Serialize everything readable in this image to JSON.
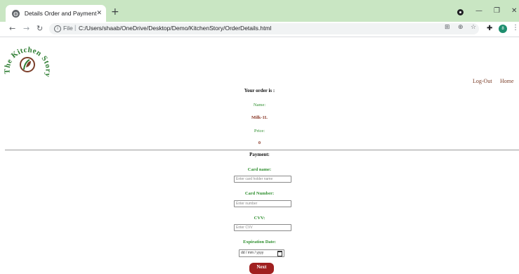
{
  "browser": {
    "tab_title": "Details Order and Payment",
    "tab_close": "✕",
    "new_tab": "+",
    "window_minimize": "—",
    "window_restore": "❐",
    "window_close": "✕",
    "omnibox_label": "File",
    "url": "C:/Users/shaab/OneDrive/Desktop/Demo/KitchenStory/OrderDetails.html",
    "profile_initial": "8"
  },
  "logo": {
    "text": "The Kitchen Story"
  },
  "nav": {
    "logout": "Log-Out",
    "home": "Home"
  },
  "order": {
    "heading": "Your order is :",
    "name_label": "Name:",
    "name_value": "Milk-1L",
    "price_label": "Price:",
    "price_value": "0"
  },
  "payment": {
    "heading": "Payment:",
    "card_name_label": "Card name:",
    "card_name_placeholder": "Enter card holder name",
    "card_number_label": "Card Number:",
    "card_number_placeholder": "Enter number",
    "cvv_label": "CVV:",
    "cvv_placeholder": "Enter CVV",
    "expiration_label": "Expiration Date:",
    "expiration_placeholder": "dd / mm / yyyy",
    "submit_label": "Next"
  },
  "colors": {
    "tabstrip": "#c9e6c3",
    "logo_green": "#2e7d32",
    "logo_brown": "#7b3f2a",
    "label_green": "#2f8f2f",
    "value_brown": "#8b3a2a",
    "button_red": "#a02020"
  }
}
